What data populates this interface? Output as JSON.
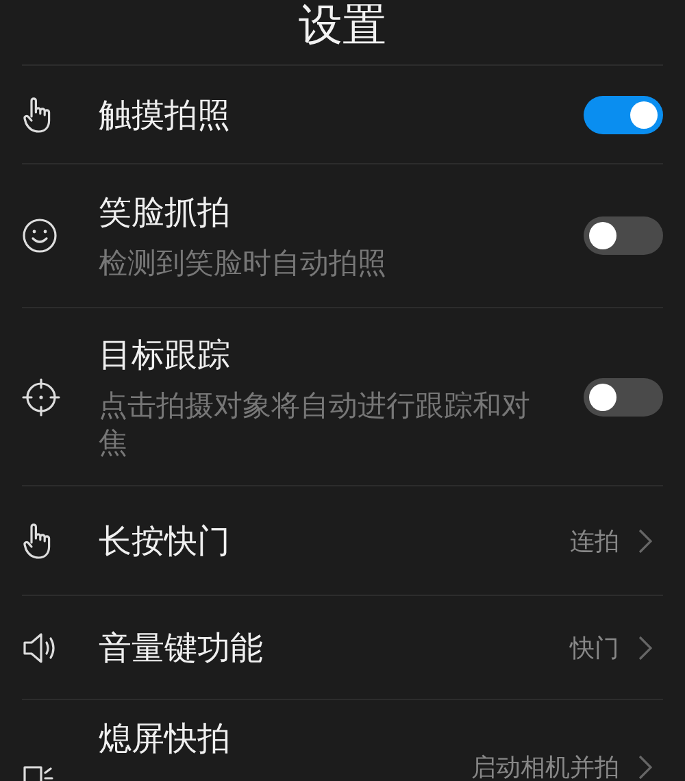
{
  "header": {
    "title": "设置"
  },
  "settings": [
    {
      "title": "触摸拍照",
      "kind": "toggle",
      "on": true
    },
    {
      "title": "笑脸抓拍",
      "description": "检测到笑脸时自动拍照",
      "kind": "toggle",
      "on": false
    },
    {
      "title": "目标跟踪",
      "description": "点击拍摄对象将自动进行跟踪和对焦",
      "kind": "toggle",
      "on": false
    },
    {
      "title": "长按快门",
      "kind": "link",
      "value": "连拍"
    },
    {
      "title": "音量键功能",
      "kind": "link",
      "value": "快门"
    },
    {
      "title": "熄屏快拍",
      "kind": "link",
      "value": "启动相机并拍"
    }
  ]
}
